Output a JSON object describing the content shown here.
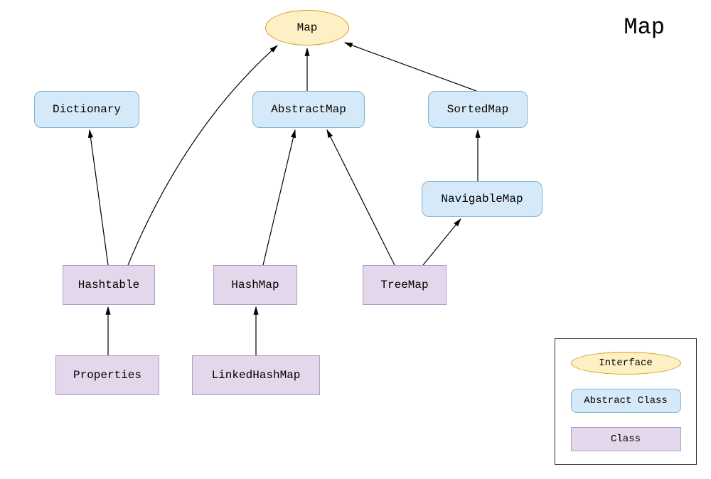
{
  "title": "Map",
  "nodes": {
    "map": {
      "label": "Map",
      "type": "interface"
    },
    "dictionary": {
      "label": "Dictionary",
      "type": "abstract"
    },
    "abstractMap": {
      "label": "AbstractMap",
      "type": "abstract"
    },
    "sortedMap": {
      "label": "SortedMap",
      "type": "abstract"
    },
    "navigableMap": {
      "label": "NavigableMap",
      "type": "abstract"
    },
    "hashtable": {
      "label": "Hashtable",
      "type": "class"
    },
    "hashMap": {
      "label": "HashMap",
      "type": "class"
    },
    "treeMap": {
      "label": "TreeMap",
      "type": "class"
    },
    "properties": {
      "label": "Properties",
      "type": "class"
    },
    "linkedHashMap": {
      "label": "LinkedHashMap",
      "type": "class"
    }
  },
  "legend": {
    "interface": "Interface",
    "abstract": "Abstract Class",
    "class": "Class"
  },
  "edges": [
    {
      "from": "abstractMap",
      "to": "map"
    },
    {
      "from": "sortedMap",
      "to": "map"
    },
    {
      "from": "hashtable",
      "to": "map"
    },
    {
      "from": "hashtable",
      "to": "dictionary"
    },
    {
      "from": "hashMap",
      "to": "abstractMap"
    },
    {
      "from": "treeMap",
      "to": "abstractMap"
    },
    {
      "from": "treeMap",
      "to": "navigableMap"
    },
    {
      "from": "navigableMap",
      "to": "sortedMap"
    },
    {
      "from": "properties",
      "to": "hashtable"
    },
    {
      "from": "linkedHashMap",
      "to": "hashMap"
    }
  ]
}
